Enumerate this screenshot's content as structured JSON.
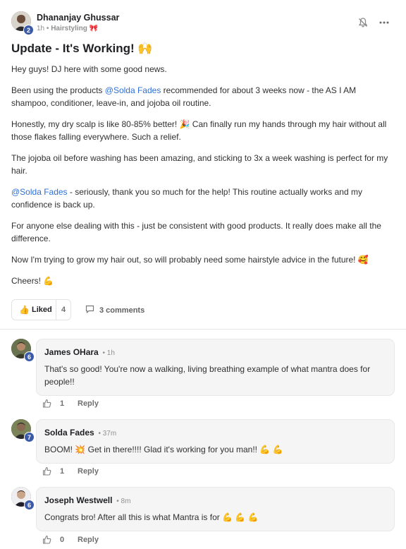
{
  "post": {
    "author": {
      "name": "Dhananjay Ghussar",
      "level": "2",
      "time": "1h",
      "category": "Hairstyling",
      "category_emoji": "🎀"
    },
    "title": "Update - It's Working! 🙌",
    "body": [
      {
        "parts": [
          {
            "text": "Hey guys! DJ here with some good news."
          }
        ]
      },
      {
        "parts": [
          {
            "text": "Been using the products "
          },
          {
            "text": "@Solda Fades",
            "mention": true
          },
          {
            "text": " recommended for about 3 weeks now - the AS I AM shampoo, conditioner, leave-in, and jojoba oil routine."
          }
        ]
      },
      {
        "parts": [
          {
            "text": "Honestly, my dry scalp is like 80-85% better! 🎉  Can finally run my hands through my hair without all those flakes falling everywhere. Such a relief."
          }
        ]
      },
      {
        "parts": [
          {
            "text": "The jojoba oil before washing has been amazing, and sticking to 3x a week washing is perfect for my hair."
          }
        ]
      },
      {
        "parts": [
          {
            "text": "@Solda Fades",
            "mention": true
          },
          {
            "text": " - seriously, thank you so much for the help! This routine actually works and my confidence is back up."
          }
        ]
      },
      {
        "parts": [
          {
            "text": "For anyone else dealing with this - just be consistent with good products. It really does make all the difference."
          }
        ]
      },
      {
        "parts": [
          {
            "text": "Now I'm trying to grow my hair out, so will probably need some hairstyle advice in the future! 🥰"
          }
        ]
      },
      {
        "parts": [
          {
            "text": "Cheers! 💪"
          }
        ]
      }
    ],
    "like_label": "Liked",
    "like_count": "4",
    "comments_label": "3 comments"
  },
  "comments": [
    {
      "name": "James OHara",
      "time": "1h",
      "level": "6",
      "text": "That's so good! You're now a walking, living breathing example of what mantra does for people!!",
      "likes": "1",
      "reply_label": "Reply",
      "avatar_color": "#4a5a3a"
    },
    {
      "name": "Solda Fades",
      "time": "37m",
      "level": "7",
      "text": "BOOM! 💥 Get in there!!!! Glad it's working for you man!! 💪 💪",
      "likes": "1",
      "reply_label": "Reply",
      "avatar_color": "#55603f"
    },
    {
      "name": "Joseph Westwell",
      "time": "8m",
      "level": "6",
      "text": "Congrats bro! After all this is what Mantra is for 💪 💪 💪",
      "likes": "0",
      "reply_label": "Reply",
      "avatar_color": "#2a2a35"
    }
  ],
  "colors": {
    "accent_link": "#2f6fd6",
    "level_badge": "#3b5aa8",
    "liked_thumb": "#c79400"
  },
  "icons": {
    "bell": "bell-off-icon",
    "more": "more-horizontal-icon",
    "like": "thumbs-up-icon",
    "comment": "comment-icon"
  }
}
